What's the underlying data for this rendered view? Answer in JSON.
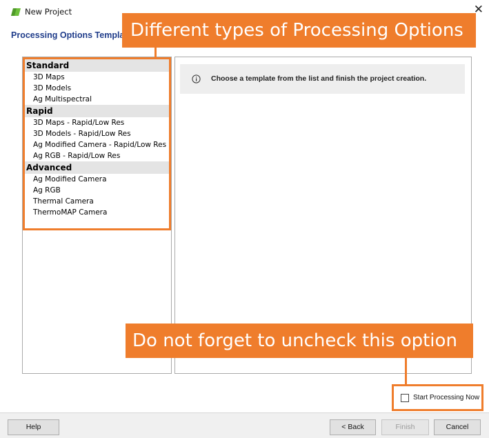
{
  "window": {
    "title": "New Project",
    "app_icon": "pix4d-green-icon",
    "close_glyph": "✕"
  },
  "page": {
    "title": "Processing Options Templa"
  },
  "templates": {
    "groups": [
      {
        "name": "Standard",
        "items": [
          "3D Maps",
          "3D Models",
          "Ag Multispectral"
        ]
      },
      {
        "name": "Rapid",
        "items": [
          "3D Maps - Rapid/Low Res",
          "3D Models - Rapid/Low Res",
          "Ag Modified Camera - Rapid/Low Res",
          "Ag RGB - Rapid/Low Res"
        ]
      },
      {
        "name": "Advanced",
        "items": [
          "Ag Modified Camera",
          "Ag RGB",
          "Thermal Camera",
          "ThermoMAP Camera"
        ]
      }
    ]
  },
  "info": {
    "icon": "info-icon",
    "message": "Choose a template from the list and finish the project creation."
  },
  "annotations": {
    "top_callout": "Different types of Processing Options",
    "bottom_callout": "Do not forget to uncheck this option",
    "accent_color": "#ef7d2c"
  },
  "start_processing": {
    "label": "Start Processing Now",
    "checked": false
  },
  "buttons": {
    "help": "Help",
    "back": "< Back",
    "finish": "Finish",
    "cancel": "Cancel"
  }
}
